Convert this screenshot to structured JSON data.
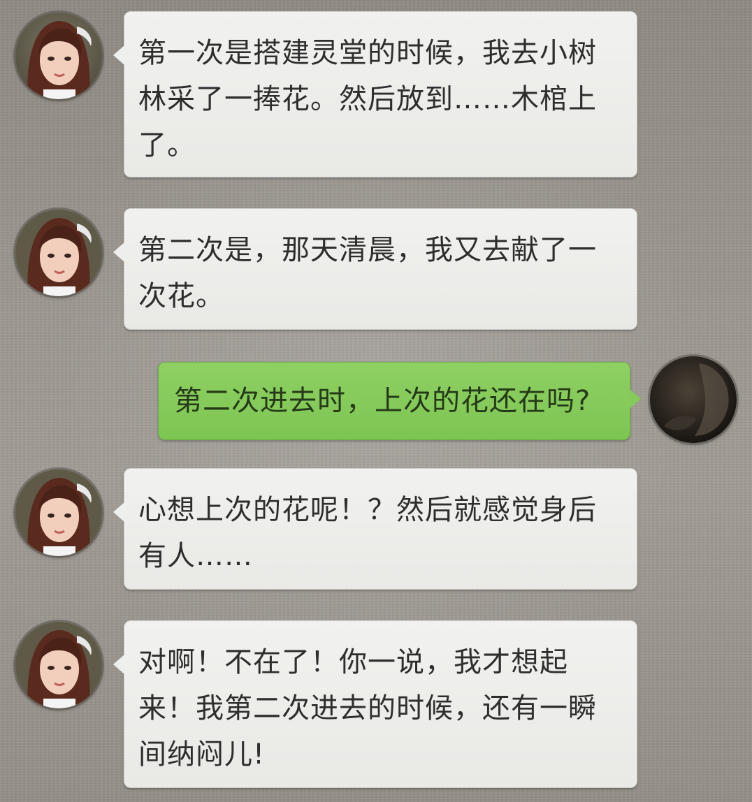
{
  "colors": {
    "incoming_bubble": "#eeeeec",
    "outgoing_bubble": "#86ca5a",
    "background": "#9d9891"
  },
  "messages": [
    {
      "sender": "girl",
      "avatar_icon": "girl-avatar-icon",
      "text": "第一次是搭建灵堂的时候，我去小树林采了一捧花。然后放到……木棺上了。"
    },
    {
      "sender": "girl",
      "avatar_icon": "girl-avatar-icon",
      "text": "第二次是，那天清晨，我又去献了一次花。"
    },
    {
      "sender": "me",
      "avatar_icon": "dark-avatar-icon",
      "text": "第二次进去时，上次的花还在吗?"
    },
    {
      "sender": "girl",
      "avatar_icon": "girl-avatar-icon",
      "text": "心想上次的花呢！？然后就感觉身后有人……"
    },
    {
      "sender": "girl",
      "avatar_icon": "girl-avatar-icon",
      "text": "对啊！不在了！你一说，我才想起来！我第二次进去的时候，还有一瞬间纳闷儿!"
    }
  ]
}
